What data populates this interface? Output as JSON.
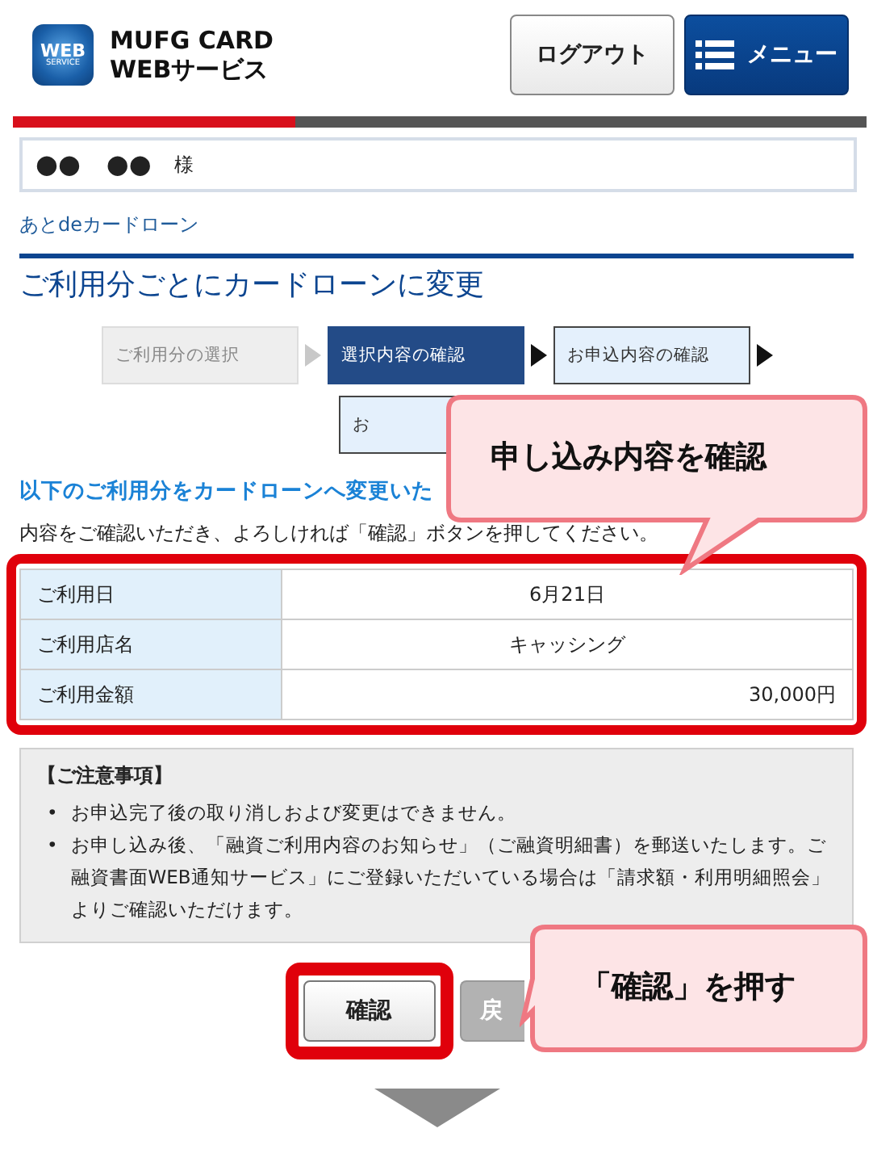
{
  "header": {
    "logo": {
      "badge_top": "WEB",
      "badge_bottom": "SERVICE",
      "line1": "MUFG CARD",
      "line2": "WEBサービス"
    },
    "buttons": [
      {
        "label": "ログアウト",
        "kind": "logout"
      },
      {
        "label": "メニュー",
        "kind": "menu"
      }
    ]
  },
  "user": {
    "name": "●●　●●",
    "honorific": "様"
  },
  "breadcrumb": "あとdeカードローン",
  "title": "ご利用分ごとにカードローンに変更",
  "steps": [
    {
      "label": "ご利用分の選択",
      "done": true,
      "selected": false
    },
    {
      "label": "選択内容の確認",
      "done": false,
      "selected": true
    },
    {
      "label": "お申込内容の確認",
      "done": false,
      "selected": false
    },
    {
      "label": "お",
      "done": false,
      "selected": false
    }
  ],
  "section_heading": "以下のご利用分をカードローンへ変更いた",
  "instruction": "内容をご確認いただき、よろしければ「確認」ボタンを押してください。",
  "table": {
    "rows": [
      {
        "label": "ご利用日",
        "value": "6月21日",
        "kind": "text"
      },
      {
        "label": "ご利用店名",
        "value": "キャッシング",
        "kind": "text"
      },
      {
        "label": "ご利用金額",
        "value": "30,000円",
        "kind": "amount"
      }
    ]
  },
  "notes": {
    "title": "【ご注意事項】",
    "items": [
      {
        "bullet": "•",
        "text": "お申込完了後の取り消しおよび変更はできません。"
      },
      {
        "bullet": "•",
        "text": "お申し込み後、「融資ご利用内容のお知らせ」（ご融資明細書）を郵送いたします。ご融資書面WEB通知サービス」にご登録いただいている場合は「請求額・利用明細照会」よりご確認いただけます。"
      }
    ]
  },
  "actions": [
    {
      "label": "確認",
      "kind": "primary"
    },
    {
      "label": "戻",
      "kind": "secondary"
    }
  ],
  "callouts": [
    {
      "text": "申し込み内容を確認",
      "kind": "down"
    },
    {
      "text": "「確認」を押す",
      "kind": "left"
    }
  ]
}
